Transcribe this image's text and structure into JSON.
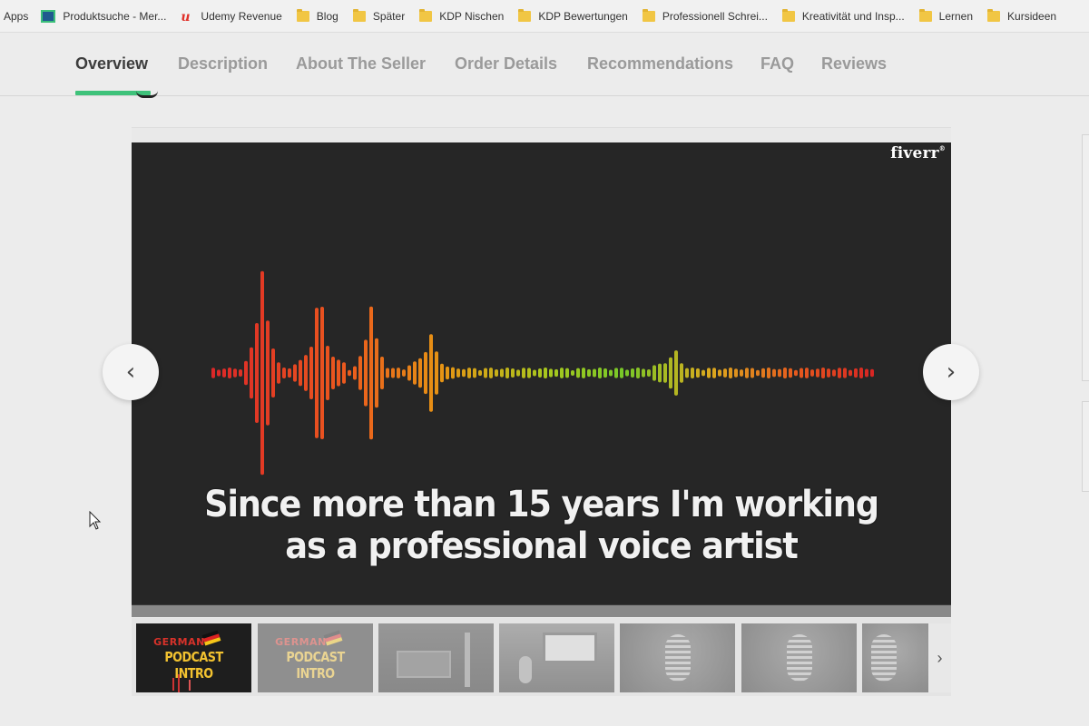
{
  "bookmarks": [
    {
      "label": "Apps",
      "icon": "apps-icon"
    },
    {
      "label": "Produktsuche - Mer...",
      "icon": "site-icon"
    },
    {
      "label": "Udemy Revenue",
      "icon": "udemy-icon"
    },
    {
      "label": "Blog",
      "icon": "folder-icon"
    },
    {
      "label": "Später",
      "icon": "folder-icon"
    },
    {
      "label": "KDP Nischen",
      "icon": "folder-icon"
    },
    {
      "label": "KDP Bewertungen",
      "icon": "folder-icon"
    },
    {
      "label": "Professionell Schrei...",
      "icon": "folder-icon"
    },
    {
      "label": "Kreativität und Insp...",
      "icon": "folder-icon"
    },
    {
      "label": "Lernen",
      "icon": "folder-icon"
    },
    {
      "label": "Kursideen",
      "icon": "folder-icon"
    }
  ],
  "tabs": [
    {
      "label": "Overview",
      "active": true
    },
    {
      "label": "Description",
      "active": false
    },
    {
      "label": "About The Seller",
      "active": false
    },
    {
      "label": "Order Details",
      "active": false
    },
    {
      "label": "Recommendations",
      "active": false
    },
    {
      "label": "FAQ",
      "active": false
    },
    {
      "label": "Reviews",
      "active": false
    }
  ],
  "video": {
    "logo": "fiverr",
    "caption_line1": "Since more than 15 years I'm working",
    "caption_line2": "as a professional voice artist"
  },
  "thumbnails": [
    {
      "line1": "GERMAN",
      "line2": "PODCAST INTRO",
      "kind": "title-card",
      "selected": true
    },
    {
      "line1": "GERMAN",
      "line2": "PODCAST INTRO",
      "kind": "title-card",
      "selected": false
    },
    {
      "kind": "studio-photo",
      "selected": false
    },
    {
      "kind": "studio-photo",
      "selected": false
    },
    {
      "kind": "microphone-photo",
      "selected": false
    },
    {
      "kind": "microphone-photo",
      "selected": false
    },
    {
      "kind": "microphone-photo",
      "selected": false
    }
  ],
  "colors": {
    "accent": "#3ec27a",
    "video_bg": "#262626",
    "tab_active": "#3d3d3d",
    "tab_inactive": "#9a9a9a"
  }
}
